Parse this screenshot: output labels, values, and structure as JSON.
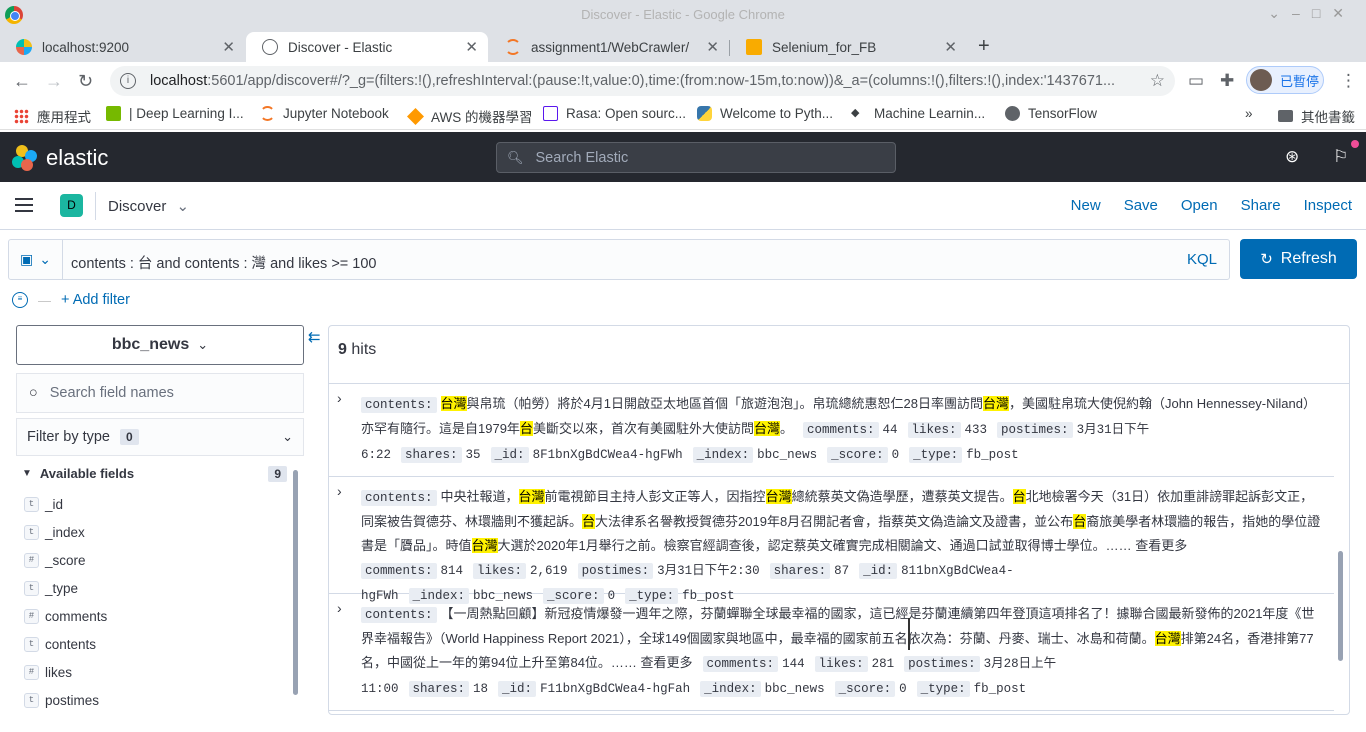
{
  "window": {
    "title": "Discover - Elastic - Google Chrome"
  },
  "tabs": [
    {
      "label": "localhost:9200",
      "icon": "elastic-favicon"
    },
    {
      "label": "Discover - Elastic",
      "icon": "kibana-favicon",
      "active": true
    },
    {
      "label": "assignment1/WebCrawler/",
      "icon": "jupyter-favicon"
    },
    {
      "label": "Selenium_for_FB",
      "icon": "notebook-favicon"
    }
  ],
  "address": {
    "host": "localhost",
    "path": ":5601/app/discover#/?_g=(filters:!(),refreshInterval:(pause:!t,value:0),time:(from:now-15m,to:now))&_a=(columns:!(),filters:!(),index:'1437671..."
  },
  "profile": {
    "label": "已暫停"
  },
  "bookmarks": [
    {
      "label": "應用程式",
      "icon": "apps-grid-icon"
    },
    {
      "label": "| Deep Learning I...",
      "icon": "nvidia-icon"
    },
    {
      "label": "Jupyter Notebook",
      "icon": "jupyter-icon"
    },
    {
      "label": "AWS 的機器學習",
      "icon": "aws-icon"
    },
    {
      "label": "Rasa: Open sourc...",
      "icon": "rasa-icon"
    },
    {
      "label": "Welcome to Pyth...",
      "icon": "python-icon"
    },
    {
      "label": "Machine Learnin...",
      "icon": "ml-icon"
    },
    {
      "label": "TensorFlow",
      "icon": "globe-icon"
    },
    {
      "label": "其他書籤",
      "icon": "folder-icon"
    }
  ],
  "kibana": {
    "brand": "elastic",
    "search_placeholder": "Search Elastic",
    "app_badge": "D",
    "app_name": "Discover",
    "nav": [
      "New",
      "Save",
      "Open",
      "Share",
      "Inspect"
    ],
    "query": "contents : 台 and contents : 灣 and likes >= 100",
    "query_lang": "KQL",
    "refresh_label": "Refresh",
    "add_filter": "+ Add filter"
  },
  "sidebar": {
    "index_pattern": "bbc_news",
    "field_search_placeholder": "Search field names",
    "filter_by_type": "Filter by type",
    "filter_count": "0",
    "available_label": "Available fields",
    "available_count": "9",
    "fields": [
      {
        "type": "t",
        "name": "_id"
      },
      {
        "type": "t",
        "name": "_index"
      },
      {
        "type": "#",
        "name": "_score"
      },
      {
        "type": "t",
        "name": "_type"
      },
      {
        "type": "#",
        "name": "comments"
      },
      {
        "type": "t",
        "name": "contents"
      },
      {
        "type": "#",
        "name": "likes"
      },
      {
        "type": "t",
        "name": "postimes"
      }
    ]
  },
  "results": {
    "hits_count": "9",
    "hits_label": "hits",
    "docs": [
      {
        "contents_segments": [
          {
            "t": "台灣",
            "hl": true
          },
          {
            "t": "與帛琉（帕勞）將於4月1日開啟亞太地區首個「旅遊泡泡」。帛琉總統惠恕仁28日率團訪問"
          },
          {
            "t": "台灣",
            "hl": true
          },
          {
            "t": "，美國駐帛琉大使倪約翰（John Hennessey-Niland）亦罕有隨行。這是自1979年"
          },
          {
            "t": "台",
            "hl": true
          },
          {
            "t": "美斷交以來，首次有美國駐外大使訪問"
          },
          {
            "t": "台灣",
            "hl": true
          },
          {
            "t": "。"
          }
        ],
        "comments": "44",
        "likes": "433",
        "postimes": "3月31日下午6:22",
        "shares": "35",
        "_id": "8F1bnXgBdCWea4-hgFWh",
        "_index": "bbc_news",
        "_score": "0",
        "_type": "fb_post"
      },
      {
        "contents_segments": [
          {
            "t": "中央社報道，"
          },
          {
            "t": "台灣",
            "hl": true
          },
          {
            "t": "前電視節目主持人彭文正等人，因指控"
          },
          {
            "t": "台灣",
            "hl": true
          },
          {
            "t": "總統蔡英文偽造學歷，遭蔡英文提告。"
          },
          {
            "t": "台",
            "hl": true
          },
          {
            "t": "北地檢署今天（31日）依加重誹謗罪起訴彭文正，同案被告賀德芬、林環牆則不獲起訴。"
          },
          {
            "t": "台",
            "hl": true
          },
          {
            "t": "大法律系名譽教授賀德芬2019年8月召開記者會，指蔡英文偽造論文及證書，並公布"
          },
          {
            "t": "台",
            "hl": true
          },
          {
            "t": "裔旅美學者林環牆的報告，指她的學位證書是「贗品」。時值"
          },
          {
            "t": "台灣",
            "hl": true
          },
          {
            "t": "大選於2020年1月舉行之前。檢察官經調查後，認定蔡英文確實完成相關論文、通過口試並取得博士學位。…… 查看更多"
          }
        ],
        "comments": "814",
        "likes": "2,619",
        "postimes": "3月31日下午2:30",
        "shares": "87",
        "_id": "811bnXgBdCWea4-hgFWh",
        "_index": "bbc_news",
        "_score": "0",
        "_type": "fb_post"
      },
      {
        "contents_segments": [
          {
            "t": "【一周熱點回顧】新冠疫情爆發一週年之際，芬蘭蟬聯全球最幸福的國家，這已經是芬蘭連續第四年登頂這項排名了！據聯合國最新發佈的2021年度《世界幸福報告》（World Happiness Report 2021），全球149個國家與地區中，最幸福的國家前五名依次為：芬蘭、丹麥、瑞士、冰島和荷蘭。"
          },
          {
            "t": "台灣",
            "hl": true
          },
          {
            "t": "排第24名，香港排第77名，中國從上一年的第94位上升至第84位。…… 查看更多"
          }
        ],
        "comments": "144",
        "likes": "281",
        "postimes": "3月28日上午11:00",
        "shares": "18",
        "_id": "F11bnXgBdCWea4-hgFah",
        "_index": "bbc_news",
        "_score": "0",
        "_type": "fb_post"
      }
    ]
  },
  "colors": {
    "accent": "#006bb4",
    "header_bg": "#25282f",
    "highlight": "#fff200",
    "badge": "#1bb6a0"
  }
}
